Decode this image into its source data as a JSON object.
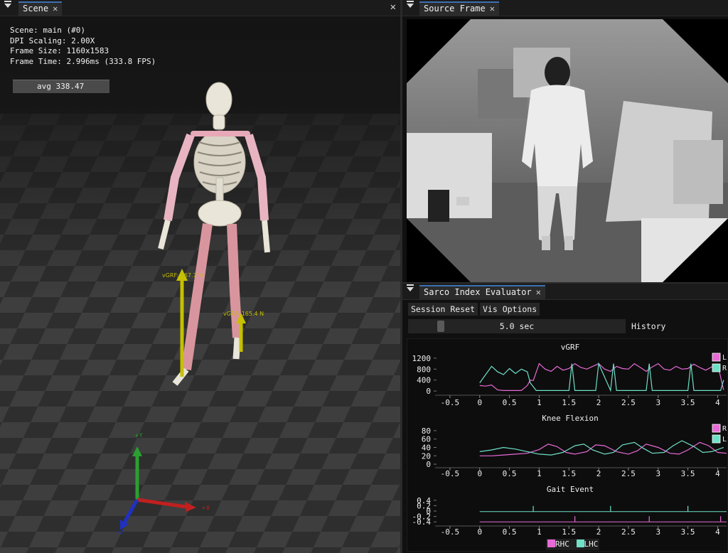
{
  "scene_panel": {
    "tab_label": "Scene",
    "info_lines": [
      "Scene: main (#0)",
      "DPI Scaling: 2.00X",
      "Frame Size: 1160x1583",
      "Frame Time: 2.996ms (333.8 FPS)"
    ],
    "avg_label": "avg 338.47",
    "force_labels": [
      "vGRF: 567.7 N",
      "vGRF: 165.4 N"
    ],
    "axis_labels": {
      "x": "+X",
      "y": "+Y",
      "z": "+Z"
    }
  },
  "source_panel": {
    "tab_label": "Source Frame"
  },
  "evaluator_panel": {
    "tab_label": "Sarco Index Evaluator",
    "session_reset": "Session Reset",
    "vis_options": "Vis Options",
    "window_value": "5.0 sec",
    "history_label": "History",
    "colors": {
      "pink": "#e86ad6",
      "teal": "#6fe0c8"
    },
    "legend_bottom": [
      "RHC",
      "LHC"
    ]
  },
  "chart_data": [
    {
      "type": "line",
      "title": "vGRF",
      "x_ticks": [
        "-0.5",
        "0",
        "0.5",
        "1",
        "1.5",
        "2",
        "2.5",
        "3",
        "3.5",
        "4"
      ],
      "y_ticks": [
        "1200",
        "800",
        "400",
        "0"
      ],
      "ylim": [
        -100,
        1300
      ],
      "xlim": [
        -0.75,
        4.15
      ],
      "legend": [
        "L",
        "R"
      ],
      "series": [
        {
          "name": "L",
          "color": "#e86ad6",
          "x": [
            0,
            0.1,
            0.2,
            0.3,
            0.4,
            0.5,
            0.7,
            0.8,
            0.85,
            0.9,
            1.0,
            1.1,
            1.2,
            1.3,
            1.4,
            1.5,
            1.6,
            1.7,
            1.8,
            1.9,
            2.0,
            2.1,
            2.2,
            2.3,
            2.4,
            2.5,
            2.6,
            2.7,
            2.8,
            2.9,
            3.0,
            3.1,
            3.2,
            3.3,
            3.4,
            3.5,
            3.6,
            3.7,
            3.8,
            3.9,
            4.0,
            4.1
          ],
          "y": [
            200,
            180,
            220,
            40,
            20,
            20,
            20,
            200,
            400,
            380,
            1000,
            800,
            720,
            900,
            760,
            820,
            1000,
            860,
            800,
            900,
            1000,
            800,
            720,
            900,
            820,
            800,
            1000,
            860,
            720,
            880,
            1000,
            800,
            760,
            900,
            800,
            820,
            980,
            860,
            760,
            880,
            980,
            40
          ]
        },
        {
          "name": "R",
          "color": "#6fe0c8",
          "x": [
            0,
            0.1,
            0.2,
            0.3,
            0.4,
            0.5,
            0.6,
            0.7,
            0.8,
            0.85,
            0.95,
            1.0,
            1.05,
            1.5,
            1.55,
            1.6,
            1.7,
            1.8,
            1.95,
            2.0,
            2.2,
            2.25,
            2.3,
            2.8,
            2.85,
            2.9,
            3.5,
            3.55,
            3.6,
            4.05,
            4.1
          ],
          "y": [
            300,
            600,
            900,
            700,
            600,
            820,
            640,
            800,
            700,
            300,
            20,
            20,
            20,
            20,
            1000,
            20,
            20,
            20,
            20,
            1000,
            20,
            1000,
            20,
            20,
            1000,
            20,
            20,
            1000,
            20,
            20,
            400
          ]
        }
      ]
    },
    {
      "type": "line",
      "title": "Knee Flexion",
      "x_ticks": [
        "-0.5",
        "0",
        "0.5",
        "1",
        "1.5",
        "2",
        "2.5",
        "3",
        "3.5",
        "4"
      ],
      "y_ticks": [
        "80",
        "60",
        "40",
        "20",
        "0"
      ],
      "ylim": [
        -5,
        90
      ],
      "xlim": [
        -0.75,
        4.15
      ],
      "legend": [
        "R",
        "L"
      ],
      "series": [
        {
          "name": "R",
          "color": "#e86ad6",
          "x": [
            0,
            0.2,
            0.4,
            0.6,
            0.8,
            1.0,
            1.15,
            1.3,
            1.45,
            1.6,
            1.8,
            1.95,
            2.1,
            2.3,
            2.5,
            2.65,
            2.8,
            3.0,
            3.2,
            3.35,
            3.5,
            3.7,
            3.85,
            4.0,
            4.15
          ],
          "y": [
            20,
            20,
            22,
            24,
            26,
            35,
            48,
            42,
            28,
            24,
            30,
            46,
            44,
            30,
            24,
            32,
            48,
            40,
            26,
            24,
            34,
            52,
            44,
            28,
            26
          ]
        },
        {
          "name": "L",
          "color": "#6fe0c8",
          "x": [
            0,
            0.2,
            0.4,
            0.6,
            0.8,
            1.0,
            1.2,
            1.4,
            1.6,
            1.75,
            1.9,
            2.1,
            2.25,
            2.4,
            2.6,
            2.75,
            2.9,
            3.1,
            3.25,
            3.4,
            3.6,
            3.75,
            3.9,
            4.1
          ],
          "y": [
            30,
            34,
            40,
            36,
            30,
            24,
            22,
            28,
            44,
            48,
            34,
            24,
            28,
            46,
            52,
            38,
            26,
            28,
            44,
            56,
            42,
            28,
            30,
            40
          ]
        }
      ]
    },
    {
      "type": "line",
      "title": "Gait Event",
      "x_ticks": [
        "-0.5",
        "0",
        "0.5",
        "1",
        "1.5",
        "2",
        "2.5",
        "3",
        "3.5",
        "4"
      ],
      "y_ticks": [
        "0.4",
        "0.2",
        "0",
        "-0.2",
        "-0.4"
      ],
      "ylim": [
        -0.5,
        0.5
      ],
      "xlim": [
        -0.75,
        4.15
      ],
      "legend": [
        "RHC",
        "LHC"
      ],
      "events": [
        {
          "name": "RHC",
          "color": "#e86ad6",
          "baseline": -0.4,
          "x": [
            1.6,
            2.85,
            4.05
          ]
        },
        {
          "name": "LHC",
          "color": "#6fe0c8",
          "baseline": -0.02,
          "x": [
            0.9,
            2.2,
            3.5
          ]
        }
      ]
    }
  ]
}
